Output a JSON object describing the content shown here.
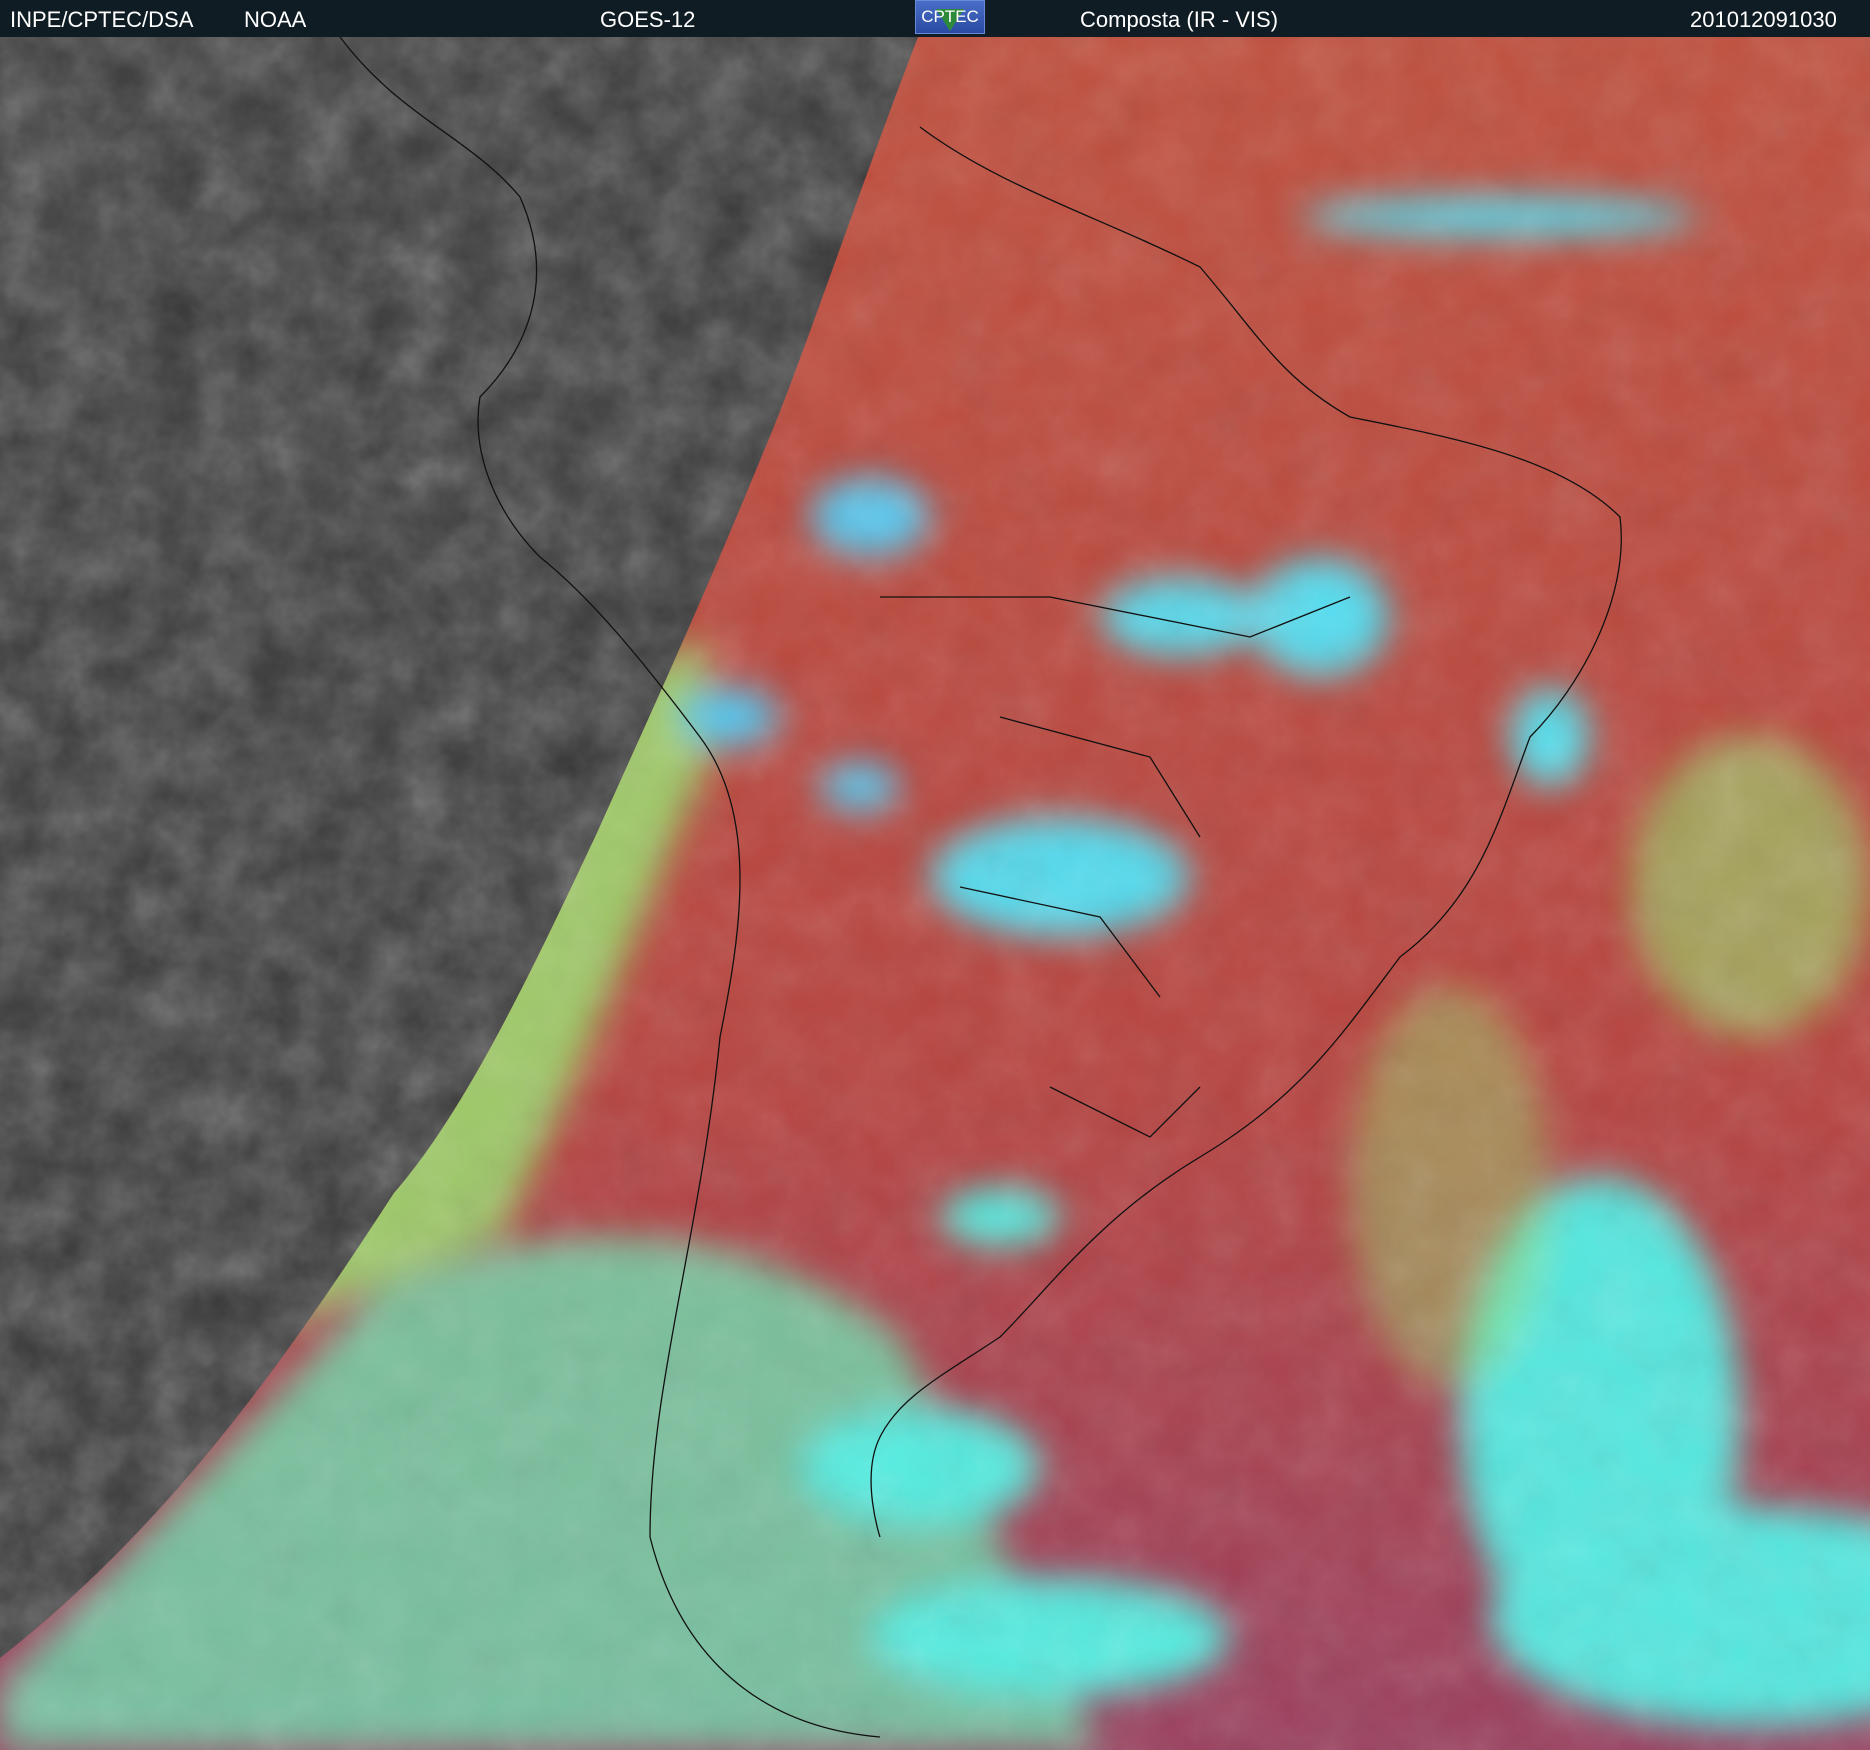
{
  "header": {
    "agency": "INPE/CPTEC/DSA",
    "source": "NOAA",
    "satellite": "GOES-12",
    "logo_text": "CPTEC",
    "product": "Composta (IR - VIS)",
    "timestamp": "201012091030"
  },
  "colors": {
    "header_bg": "#101c24",
    "night_gray": "#3a3a3a",
    "ir_red": "#b5473f",
    "cloud_cyan": "#4fe6e0",
    "cloud_green": "#9ee86a"
  }
}
